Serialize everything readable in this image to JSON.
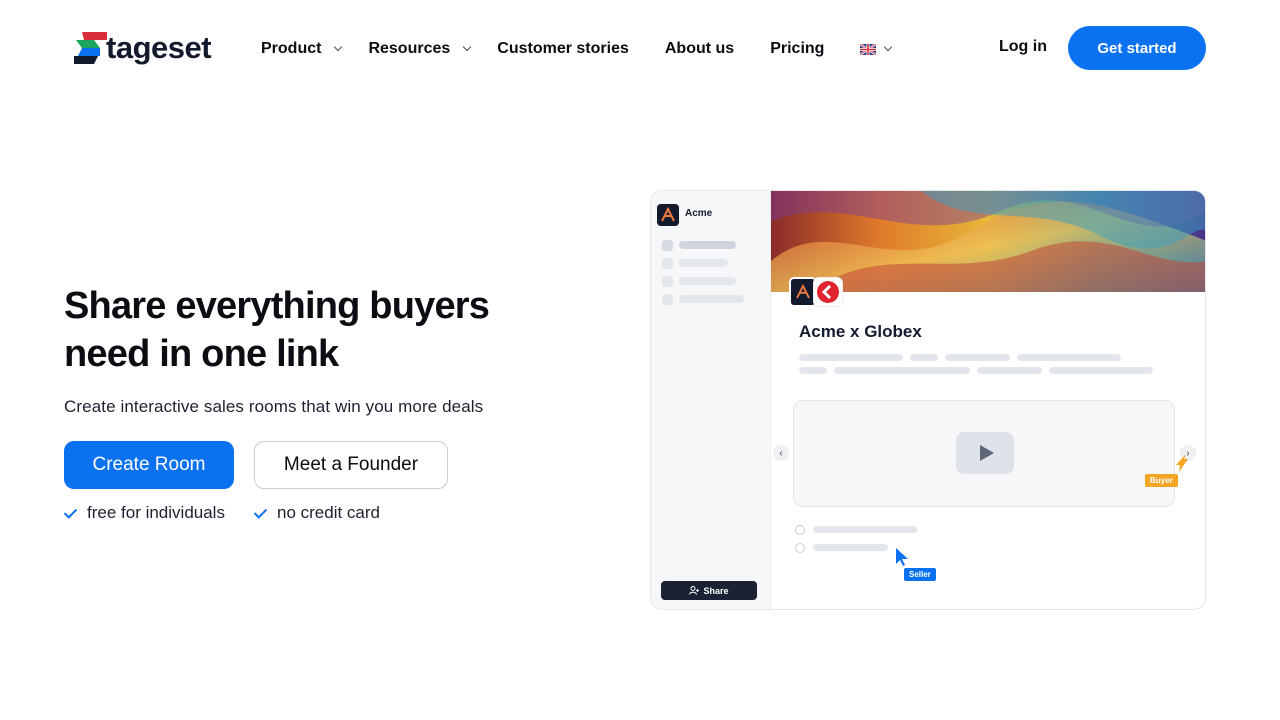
{
  "brand": {
    "name": "tageset",
    "accent": "#0a72f0"
  },
  "nav": {
    "items": [
      {
        "label": "Product",
        "dropdown": true
      },
      {
        "label": "Resources",
        "dropdown": true
      },
      {
        "label": "Customer stories",
        "dropdown": false
      },
      {
        "label": "About us",
        "dropdown": false
      },
      {
        "label": "Pricing",
        "dropdown": false
      }
    ],
    "language_icon": "uk-flag-icon",
    "login_label": "Log in",
    "cta_label": "Get started"
  },
  "hero": {
    "title": "Share everything buyers need in one link",
    "subtitle": "Create interactive sales rooms that win you more deals",
    "primary_button": "Create Room",
    "secondary_button": "Meet a Founder",
    "perks": [
      "free for individuals",
      "no credit card"
    ]
  },
  "mockup": {
    "workspace_name": "Acme",
    "room_title": "Acme x Globex",
    "share_label": "Share",
    "buyer_label": "Buyer",
    "seller_label": "Seller",
    "buyer_color": "#f5a524",
    "seller_color": "#0a72f0"
  }
}
